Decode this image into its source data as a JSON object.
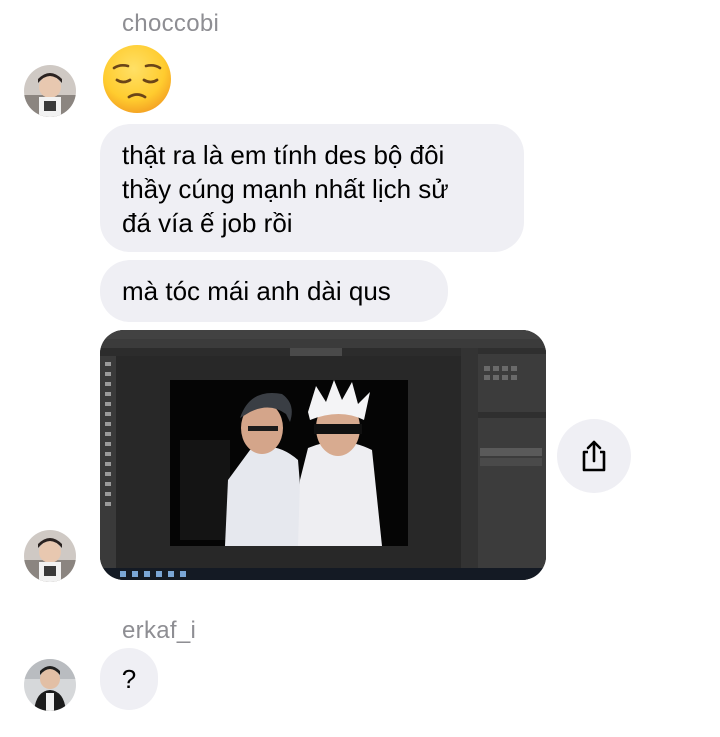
{
  "conversation": {
    "first_sender": {
      "username": "choccobi"
    },
    "second_sender": {
      "username": "erkaf_i"
    },
    "messages": [
      {
        "type": "emoji",
        "content": "pensive-face"
      },
      {
        "type": "text",
        "lines": [
          "thật ra là em tính des bộ đôi",
          "thầy cúng mạnh nhất lịch sử",
          "đá vía ế job rồi"
        ]
      },
      {
        "type": "text",
        "lines": [
          "mà tóc mái anh dài qus"
        ]
      },
      {
        "type": "image",
        "content": "photoshop-editor-screenshot"
      },
      {
        "type": "text",
        "lines": [
          "?"
        ]
      }
    ]
  },
  "colors": {
    "bubble_bg": "#efeff4",
    "username_text": "#8e8e93",
    "share_bg": "#efeff4"
  },
  "icons": {
    "share": "share-icon"
  }
}
